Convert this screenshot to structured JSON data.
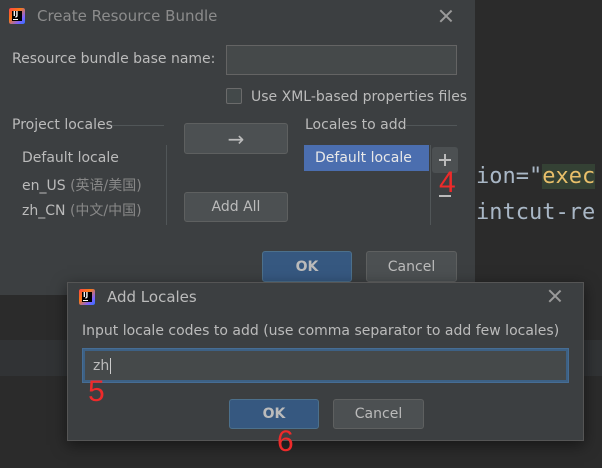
{
  "editor": {
    "line1": {
      "prefix": "ion=\"",
      "value": "exec"
    },
    "line2": {
      "text": "intcut-re"
    }
  },
  "create_bundle_dialog": {
    "title": "Create Resource Bundle",
    "base_name_label": "Resource bundle base name:",
    "base_name_value": "",
    "use_xml_label": "Use XML-based properties files",
    "use_xml_checked": false,
    "project_locales_header": "Project locales",
    "project_locales": [
      {
        "code": "Default locale",
        "native": ""
      },
      {
        "code": "en_US",
        "native": "(英语/美国)"
      },
      {
        "code": "zh_CN",
        "native": "(中文/中国)"
      }
    ],
    "move_arrow": "→",
    "add_all_label": "Add All",
    "locales_to_add_header": "Locales to add",
    "locales_to_add": [
      "Default locale"
    ],
    "ok_label": "OK",
    "cancel_label": "Cancel"
  },
  "add_locales_dialog": {
    "title": "Add Locales",
    "prompt": "Input locale codes to add (use comma separator to add few locales)",
    "input_value": "zh",
    "ok_label": "OK",
    "cancel_label": "Cancel"
  },
  "annotations": {
    "step4": "4",
    "step5": "5",
    "step6": "6"
  },
  "colors": {
    "dialog_bg": "#3c3f41",
    "editor_bg": "#2b2b2b",
    "primary_button": "#365880",
    "selection": "#4b6eaf",
    "annotation": "#ee2a2a"
  }
}
